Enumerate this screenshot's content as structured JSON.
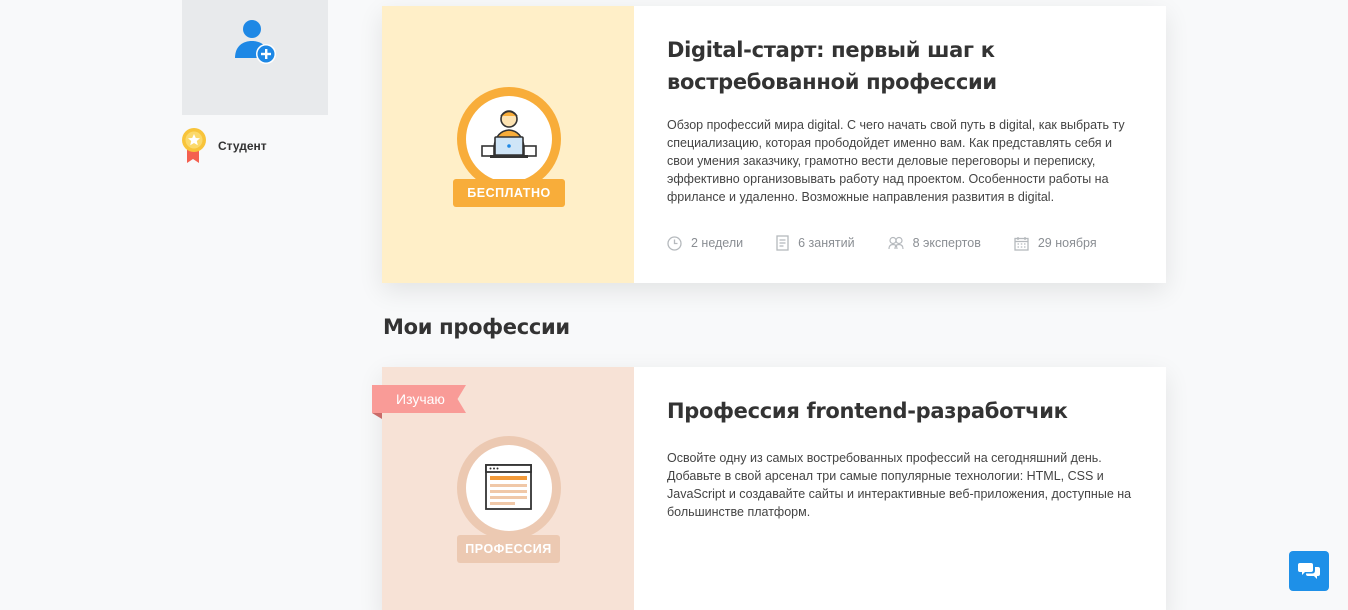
{
  "sidebar": {
    "role_label": "Студент"
  },
  "free_course": {
    "title": "Digital-старт: первый шаг к востребованной профессии",
    "description": "Обзор профессий мира digital. С чего начать свой путь в digital, как выбрать ту специализацию, которая прободойдет именно вам. Как представлять себя и свои умения заказчику, грамотно вести деловые переговоры и переписку, эффективно организовывать работу над проектом. Особенности работы на фрилансе и удаленно. Возможные направления развития в digital.",
    "badge": "БЕСПЛАТНО",
    "meta": {
      "duration": "2 недели",
      "lessons": "6 занятий",
      "experts": "8 экспертов",
      "date": "29 ноября"
    }
  },
  "section": {
    "title": "Мои профессии"
  },
  "profession": {
    "tag": "Изучаю",
    "title": "Профессия frontend-разработчик",
    "description": "Освойте одну из самых востребованных профессий на сегодняшний день. Добавьте в свой арсенал три самые популярные технологии: HTML, CSS и JavaScript и создавайте сайты и интерактивные веб-приложения, доступные на большинстве платформ.",
    "badge": "ПРОФЕССИЯ"
  },
  "colors": {
    "accent_blue": "#1e90e8",
    "free_bg": "#ffefc8",
    "free_badge": "#f8ad3a",
    "profession_bg": "#f7e2d6",
    "profession_badge": "#ecc9b2",
    "tag": "#f99b97"
  },
  "icons": {
    "avatar": "add-user-icon",
    "role": "medal-icon",
    "duration": "clock-icon",
    "lessons": "document-icon",
    "experts": "people-icon",
    "date": "calendar-icon",
    "chat": "chat-icon"
  }
}
